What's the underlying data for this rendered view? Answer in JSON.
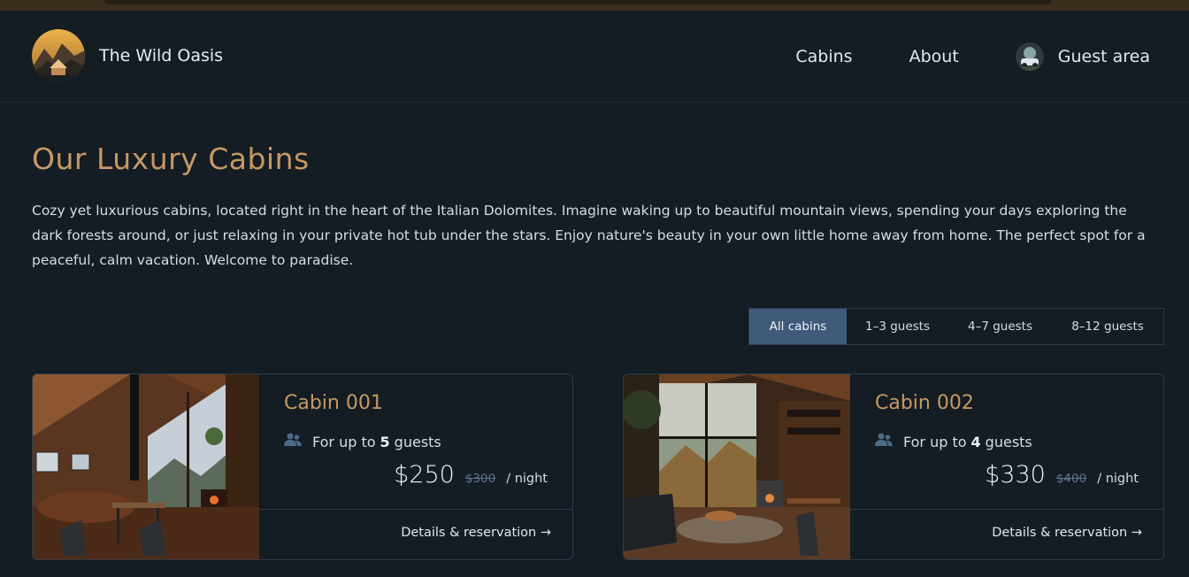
{
  "header": {
    "logo_alt": "The Wild Oasis logo",
    "brand": "The Wild Oasis",
    "nav": {
      "cabins": "Cabins",
      "about": "About",
      "guest_area": "Guest area"
    }
  },
  "main": {
    "title": "Our Luxury Cabins",
    "intro": "Cozy yet luxurious cabins, located right in the heart of the Italian Dolomites. Imagine waking up to beautiful mountain views, spending your days exploring the dark forests around, or just relaxing in your private hot tub under the stars. Enjoy nature's beauty in your own little home away from home. The perfect spot for a peaceful, calm vacation. Welcome to paradise.",
    "filter": {
      "all": "All cabins",
      "small": "1–3 guests",
      "medium": "4–7 guests",
      "large": "8–12 guests",
      "active": "all"
    },
    "cabins": [
      {
        "name": "Cabin 001",
        "guests_prefix": "For up to",
        "max_guests": "5",
        "guests_suffix": "guests",
        "price": "$250",
        "regular_price": "$300",
        "unit": "/ night",
        "link": "Details & reservation →"
      },
      {
        "name": "Cabin 002",
        "guests_prefix": "For up to",
        "max_guests": "4",
        "guests_suffix": "guests",
        "price": "$330",
        "regular_price": "$400",
        "unit": "/ night",
        "link": "Details & reservation →"
      }
    ]
  },
  "colors": {
    "background": "#141c24",
    "accent": "#c69963",
    "border": "#2c3d4f",
    "filter_active": "#3f5b79",
    "old_price": "#5d7590"
  },
  "icons": {
    "guests": "users-icon"
  }
}
